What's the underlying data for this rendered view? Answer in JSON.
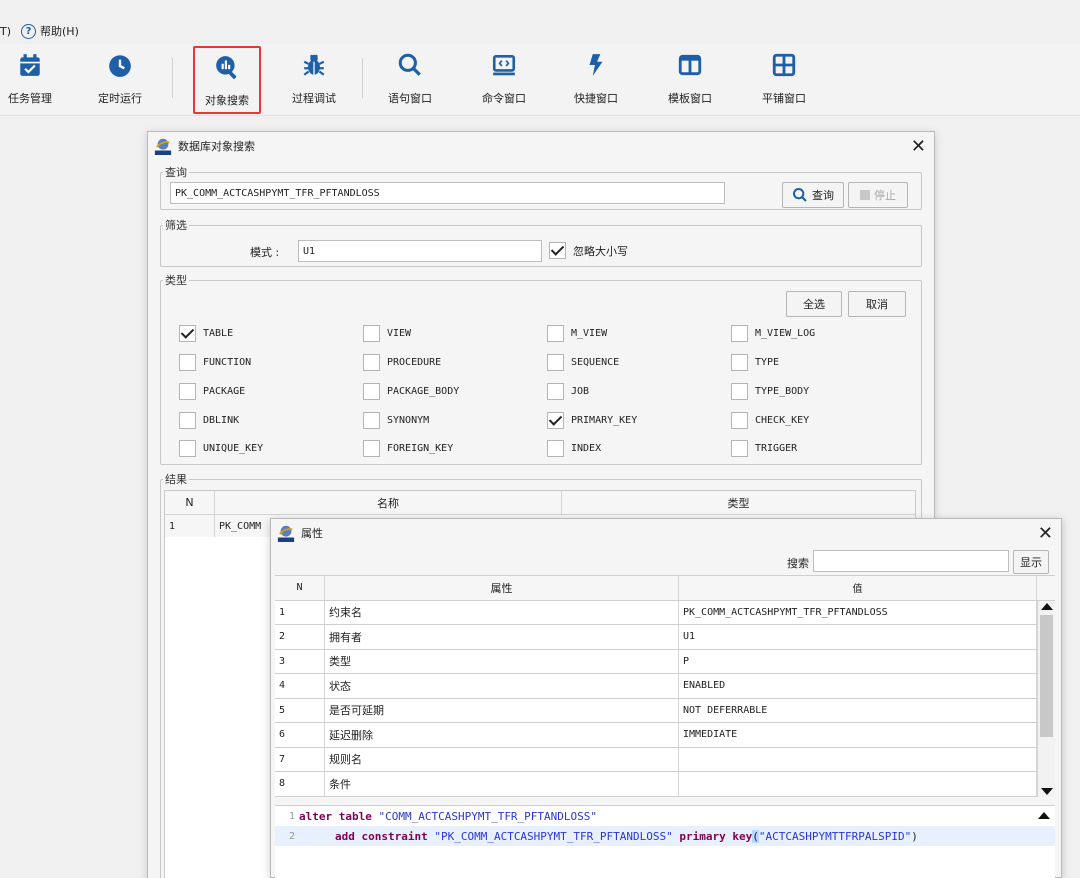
{
  "menu": {
    "partial": "T)",
    "help": "帮助(H)"
  },
  "toolbar": {
    "items": [
      {
        "label": "任务管理",
        "icon": "calendar-check-icon"
      },
      {
        "label": "定时运行",
        "icon": "clock-icon"
      },
      {
        "label": "对象搜索",
        "icon": "object-search-icon",
        "selected": true
      },
      {
        "label": "过程调试",
        "icon": "bug-icon"
      },
      {
        "label": "语句窗口",
        "icon": "search-icon"
      },
      {
        "label": "命令窗口",
        "icon": "terminal-window-icon"
      },
      {
        "label": "快捷窗口",
        "icon": "lightning-icon"
      },
      {
        "label": "模板窗口",
        "icon": "two-column-window-icon"
      },
      {
        "label": "平铺窗口",
        "icon": "four-grid-window-icon"
      }
    ],
    "accent": "#1f5fa8",
    "selected_border": "#e53935"
  },
  "search_dialog": {
    "title": "数据库对象搜索",
    "query": {
      "legend": "查询",
      "value": "PK_COMM_ACTCASHPYMT_TFR_PFTANDLOSS",
      "search_button": "查询",
      "stop_button": "停止"
    },
    "filter": {
      "legend": "筛选",
      "mode_label": "模式 :",
      "mode_value": "U1",
      "ignore_case_label": "忽略大小写",
      "ignore_case_checked": true
    },
    "types": {
      "legend": "类型",
      "select_all": "全选",
      "cancel": "取消",
      "items": [
        {
          "label": "TABLE",
          "checked": true
        },
        {
          "label": "VIEW",
          "checked": false
        },
        {
          "label": "M_VIEW",
          "checked": false
        },
        {
          "label": "M_VIEW_LOG",
          "checked": false
        },
        {
          "label": "FUNCTION",
          "checked": false
        },
        {
          "label": "PROCEDURE",
          "checked": false
        },
        {
          "label": "SEQUENCE",
          "checked": false
        },
        {
          "label": "TYPE",
          "checked": false
        },
        {
          "label": "PACKAGE",
          "checked": false
        },
        {
          "label": "PACKAGE_BODY",
          "checked": false
        },
        {
          "label": "JOB",
          "checked": false
        },
        {
          "label": "TYPE_BODY",
          "checked": false
        },
        {
          "label": "DBLINK",
          "checked": false
        },
        {
          "label": "SYNONYM",
          "checked": false
        },
        {
          "label": "PRIMARY_KEY",
          "checked": true
        },
        {
          "label": "CHECK_KEY",
          "checked": false
        },
        {
          "label": "UNIQUE_KEY",
          "checked": false
        },
        {
          "label": "FOREIGN_KEY",
          "checked": false
        },
        {
          "label": "INDEX",
          "checked": false
        },
        {
          "label": "TRIGGER",
          "checked": false
        }
      ]
    },
    "results": {
      "legend": "结果",
      "columns": [
        "N",
        "名称",
        "类型"
      ],
      "rows": [
        {
          "n": "1",
          "name": "PK_COMM"
        }
      ]
    }
  },
  "props_dialog": {
    "title": "属性",
    "search_label": "搜索",
    "search_value": "",
    "show_button": "显示",
    "columns": [
      "N",
      "属性",
      "值"
    ],
    "rows": [
      {
        "n": "1",
        "attr": "约束名",
        "value": "PK_COMM_ACTCASHPYMT_TFR_PFTANDLOSS"
      },
      {
        "n": "2",
        "attr": "拥有者",
        "value": "U1"
      },
      {
        "n": "3",
        "attr": "类型",
        "value": "P"
      },
      {
        "n": "4",
        "attr": "状态",
        "value": "ENABLED"
      },
      {
        "n": "5",
        "attr": "是否可延期",
        "value": "NOT DEFERRABLE"
      },
      {
        "n": "6",
        "attr": "延迟删除",
        "value": "IMMEDIATE"
      },
      {
        "n": "7",
        "attr": "规则名",
        "value": ""
      },
      {
        "n": "8",
        "attr": "条件",
        "value": ""
      }
    ],
    "code": {
      "line1_num": "1",
      "line1_kw": "alter table ",
      "line1_str": "\"COMM_ACTCASHPYMT_TFR_PFTANDLOSS\"",
      "line2_num": "2",
      "line2_kw1": "add constraint ",
      "line2_str1": "\"PK_COMM_ACTCASHPYMT_TFR_PFTANDLOSS\"",
      "line2_kw2": " primary key",
      "line2_paren_open": "(",
      "line2_str2": "\"ACTCASHPYMTTFRPALSPID\"",
      "line2_paren_close": ")"
    }
  }
}
